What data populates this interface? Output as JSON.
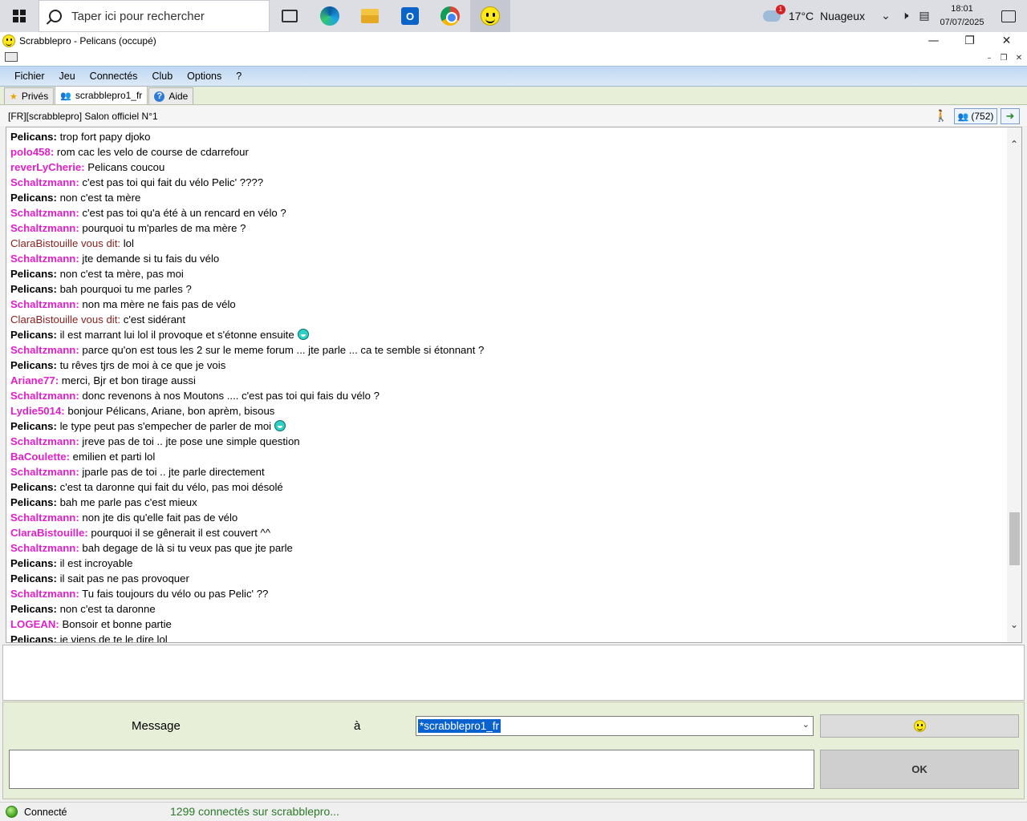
{
  "taskbar": {
    "search_placeholder": "Taper ici pour rechercher",
    "apps": [
      "task-view",
      "edge",
      "file-explorer",
      "outlook",
      "chrome",
      "scrabblepro"
    ],
    "weather_temp": "17°C",
    "weather_label": "Nuageux",
    "weather_badge": "1",
    "time": "18:01",
    "date": "07/07/2025"
  },
  "window": {
    "title": "Scrabblepro - Pelicans (occupé)"
  },
  "menu": [
    "Fichier",
    "Jeu",
    "Connectés",
    "Club",
    "Options",
    "?"
  ],
  "tabs": [
    {
      "label": "Privés",
      "icon": "star-icon"
    },
    {
      "label": "scrabblepro1_fr",
      "icon": "users-icon"
    },
    {
      "label": "Aide",
      "icon": "help-icon"
    }
  ],
  "room": {
    "title": "[FR][scrabblepro] Salon officiel N°1",
    "user_count": "(752)"
  },
  "chat": [
    {
      "nick": "Pelicans:",
      "style": "bold-black",
      "text": "trop fort papy djoko"
    },
    {
      "nick": "polo458:",
      "style": "magenta",
      "text": "rom cac les velo de course de cdarrefour"
    },
    {
      "nick": "reverLyCherie:",
      "style": "magenta",
      "text": "Pelicans coucou"
    },
    {
      "nick": "Schaltzmann:",
      "style": "magenta",
      "text": "c'est pas toi qui fait du vélo Pelic' ????"
    },
    {
      "nick": "Pelicans:",
      "style": "bold-black",
      "text": "non c'est ta mère"
    },
    {
      "nick": "Schaltzmann:",
      "style": "magenta",
      "text": "c'est pas toi qu'a été à un rencard en vélo ?"
    },
    {
      "nick": "Schaltzmann:",
      "style": "magenta",
      "text": "pourquoi tu m'parles de ma mère ?"
    },
    {
      "nick": "ClaraBistouille vous dit:",
      "style": "private",
      "text": "lol"
    },
    {
      "nick": "Schaltzmann:",
      "style": "magenta",
      "text": "jte demande si tu fais du vélo"
    },
    {
      "nick": "Pelicans:",
      "style": "bold-black",
      "text": "non c'est ta mère, pas moi"
    },
    {
      "nick": "Pelicans:",
      "style": "bold-black",
      "text": "bah pourquoi tu me parles ?"
    },
    {
      "nick": "Schaltzmann:",
      "style": "magenta",
      "text": "non ma mère ne fais pas de vélo"
    },
    {
      "nick": "ClaraBistouille vous dit:",
      "style": "private",
      "text": "c'est sidérant"
    },
    {
      "nick": "Pelicans:",
      "style": "bold-black",
      "text": "il est marrant lui lol il provoque et s'étonne ensuite",
      "emoji": true
    },
    {
      "nick": "Schaltzmann:",
      "style": "magenta",
      "text": "parce qu'on est tous les 2 sur le meme forum ... jte parle ... ca te semble si étonnant ?"
    },
    {
      "nick": "Pelicans:",
      "style": "bold-black",
      "text": "tu rêves tjrs de moi à ce que je vois"
    },
    {
      "nick": "Ariane77:",
      "style": "magenta",
      "text": "merci, Bjr et bon tirage aussi"
    },
    {
      "nick": "Schaltzmann:",
      "style": "magenta",
      "text": "donc revenons à nos Moutons .... c'est pas toi qui fais du vélo ?"
    },
    {
      "nick": "Lydie5014:",
      "style": "magenta",
      "text": "bonjour Pélicans, Ariane, bon aprèm, bisous"
    },
    {
      "nick": "Pelicans:",
      "style": "bold-black",
      "text": "le type peut pas s'empecher de parler de moi",
      "emoji": true
    },
    {
      "nick": "Schaltzmann:",
      "style": "magenta",
      "text": "jreve pas de toi .. jte pose une simple question"
    },
    {
      "nick": "BaCoulette:",
      "style": "magenta",
      "text": "emilien et parti lol"
    },
    {
      "nick": "Schaltzmann:",
      "style": "magenta",
      "text": "jparle pas de toi .. jte parle directement"
    },
    {
      "nick": "Pelicans:",
      "style": "bold-black",
      "text": "c'est ta daronne qui fait du vélo, pas moi désolé"
    },
    {
      "nick": "Pelicans:",
      "style": "bold-black",
      "text": "bah me parle pas c'est mieux"
    },
    {
      "nick": "Schaltzmann:",
      "style": "magenta",
      "text": "non jte dis qu'elle fait pas de vélo"
    },
    {
      "nick": "ClaraBistouille:",
      "style": "magenta",
      "text": "pourquoi il se gênerait il est couvert ^^"
    },
    {
      "nick": "Schaltzmann:",
      "style": "magenta",
      "text": "bah degage de là si tu veux pas que jte parle"
    },
    {
      "nick": "Pelicans:",
      "style": "bold-black",
      "text": "il est incroyable"
    },
    {
      "nick": "Pelicans:",
      "style": "bold-black",
      "text": "il sait pas ne pas provoquer"
    },
    {
      "nick": "Schaltzmann:",
      "style": "magenta",
      "text": "Tu fais toujours du vélo ou pas Pelic' ??"
    },
    {
      "nick": "Pelicans:",
      "style": "bold-black",
      "text": "non c'est ta daronne"
    },
    {
      "nick": "LOGEAN:",
      "style": "magenta",
      "text": "Bonsoir et bonne partie"
    },
    {
      "nick": "Pelicans:",
      "style": "bold-black",
      "text": "je viens de te le dire lol"
    }
  ],
  "composer": {
    "message_label": "Message",
    "to_label": "à",
    "recipient": "*scrabblepro1_fr",
    "ok_label": "OK",
    "message_value": ""
  },
  "status": {
    "state": "Connecté",
    "count_text": "1299 connectés sur scrabblepro..."
  },
  "colors": {
    "nick_magenta": "#e020c8",
    "nick_private": "#8b2020",
    "panel_green": "#e7efd9",
    "menu_blue": "#bfd8f2"
  }
}
